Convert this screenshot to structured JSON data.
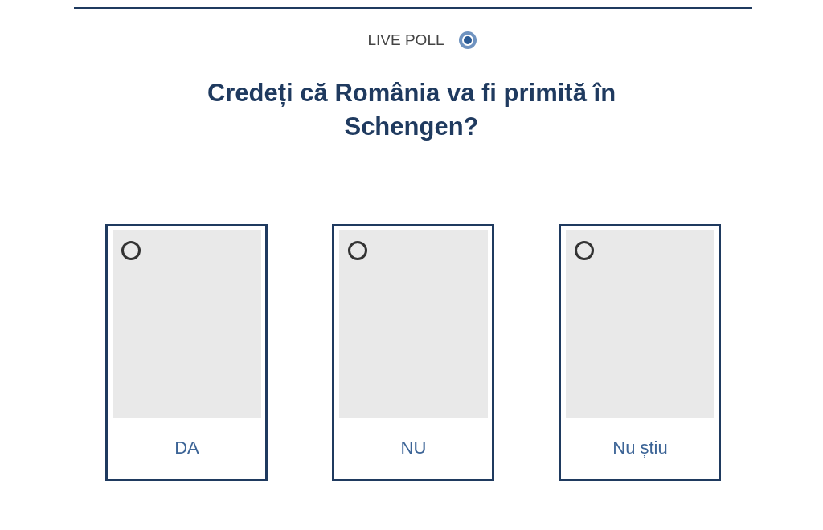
{
  "header": {
    "label": "LIVE POLL",
    "live": true
  },
  "question": "Credeți că România va fi primită în Schengen?",
  "options": [
    {
      "label": "DA",
      "selected": false
    },
    {
      "label": "NU",
      "selected": false
    },
    {
      "label": "Nu știu",
      "selected": false
    }
  ]
}
